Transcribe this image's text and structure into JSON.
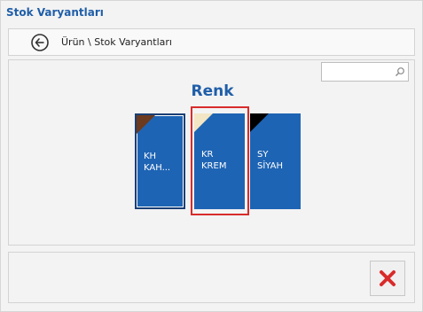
{
  "window": {
    "title": "Stok Varyantları"
  },
  "breadcrumb": {
    "back_icon": "circle-arrow-left-icon",
    "path": "Ürün \\ Stok Varyantları"
  },
  "search": {
    "value": "",
    "placeholder": "",
    "icon": "search-icon"
  },
  "group": {
    "title": "Renk"
  },
  "variants": [
    {
      "code": "KH",
      "name": "KAH...",
      "swatch_color": "#6b3a1f",
      "selected": false
    },
    {
      "code": "KR",
      "name": "KREM",
      "swatch_color": "#f3e6c4",
      "selected": true
    },
    {
      "code": "SY",
      "name": "SİYAH",
      "swatch_color": "#000000",
      "selected": false
    }
  ],
  "footer": {
    "close_icon": "close-icon",
    "close_color": "#d92b2b"
  },
  "colors": {
    "accent": "#1f5ea8",
    "tile_background": "#1e64b4",
    "selection_border": "#d92b2b"
  }
}
